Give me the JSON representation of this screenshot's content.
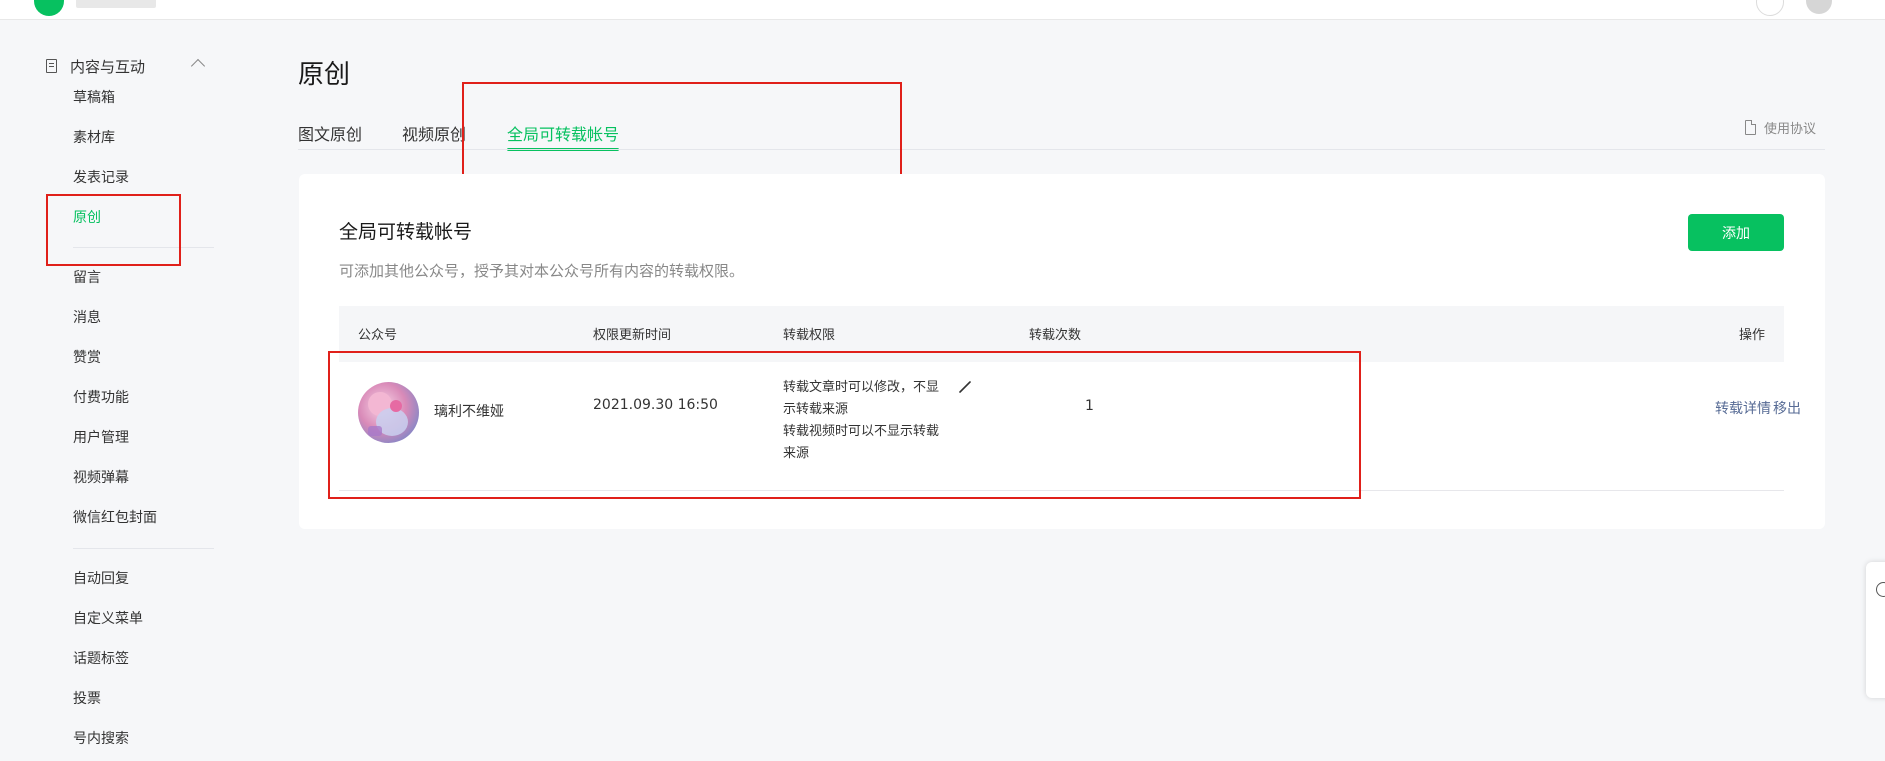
{
  "sidebar": {
    "section_label": "内容与互动",
    "items": [
      {
        "label": "草稿箱"
      },
      {
        "label": "素材库"
      },
      {
        "label": "发表记录"
      },
      {
        "label": "原创"
      },
      {
        "label": "留言"
      },
      {
        "label": "消息"
      },
      {
        "label": "赞赏"
      },
      {
        "label": "付费功能"
      },
      {
        "label": "用户管理"
      },
      {
        "label": "视频弹幕"
      },
      {
        "label": "微信红包封面"
      },
      {
        "label": "自动回复"
      },
      {
        "label": "自定义菜单"
      },
      {
        "label": "话题标签"
      },
      {
        "label": "投票"
      },
      {
        "label": "号内搜索"
      }
    ]
  },
  "main": {
    "title": "原创",
    "tabs": [
      {
        "label": "图文原创"
      },
      {
        "label": "视频原创"
      },
      {
        "label": "全局可转载帐号"
      }
    ],
    "agreement_link": "使用协议",
    "card": {
      "title": "全局可转载帐号",
      "description": "可添加其他公众号，授予其对本公众号所有内容的转载权限。",
      "add_button": "添加",
      "columns": [
        "公众号",
        "权限更新时间",
        "转载权限",
        "转载次数",
        "操作"
      ],
      "rows": [
        {
          "account": "璃利不维娅",
          "updated": "2021.09.30 16:50",
          "permission_lines": [
            "转载文章时可以修改，不显示转载来源",
            "转载视频时可以不显示转载来源"
          ],
          "count": "1",
          "actions": [
            "转载详情",
            "移出"
          ]
        }
      ]
    }
  },
  "colors": {
    "accent": "#07c160",
    "link": "#576b95",
    "highlight_box": "#e0201a"
  }
}
